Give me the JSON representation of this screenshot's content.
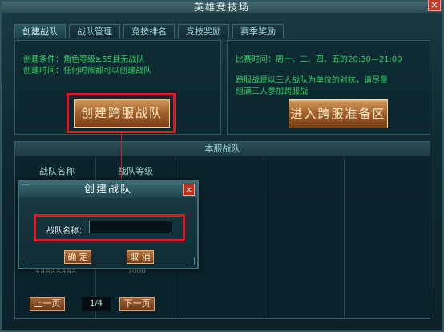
{
  "window": {
    "title": "英雄竞技场",
    "close_label": "×"
  },
  "tabs": [
    {
      "label": "创建战队",
      "active": true
    },
    {
      "label": "战队管理",
      "active": false
    },
    {
      "label": "竞技排名",
      "active": false
    },
    {
      "label": "竞技奖励",
      "active": false
    },
    {
      "label": "赛季奖励",
      "active": false
    }
  ],
  "left_panel": {
    "condition": "创建条件：角色等级≥55且无战队",
    "time": "创建时间：任何时候都可以创建战队",
    "button_label": "创建跨服战队"
  },
  "right_panel": {
    "schedule": "比赛时间：周一、二、四、五的20:30—21:00",
    "rule_line1": "跨服战是以三人战队为单位的对抗，请尽量",
    "rule_line2": "组满三人参加跨服战",
    "button_label": "进入跨服准备区"
  },
  "list_panel": {
    "title": "本服战队",
    "columns": [
      "战队名称",
      "战队等级"
    ],
    "ghost_row": {
      "name": "aaaaaaaa",
      "level": "1000"
    }
  },
  "pager": {
    "prev_label": "上一页",
    "page": "1/4",
    "next_label": "下一页"
  },
  "dialog": {
    "title": "创建战队",
    "close_label": "×",
    "field_label": "战队名称：",
    "field_value": "",
    "confirm_label": "确 定",
    "cancel_label": "取 消"
  },
  "colors": {
    "highlight": "#e01820",
    "info_text": "#2fd162",
    "gold_button": "#a15f2b"
  }
}
